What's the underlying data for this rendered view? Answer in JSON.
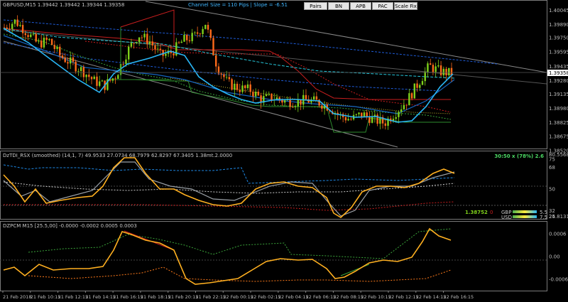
{
  "header": {
    "symbol": "GBPUSD,M15",
    "ohlc": "1.39442 1.39442 1.39344 1.39358",
    "channel": "Channel Size = 110 Pips  |  Slope = -6.51"
  },
  "toolbar": {
    "buttons": [
      "Pairs",
      "BN",
      "APB",
      "PAC",
      "Scale Fix"
    ]
  },
  "indicator1": {
    "label": "DzTDI_RSX (smoothed) (14,1, 7) 49.9533 27.0734 68.7979 62.8297 67.3405 1.38mt.2.0000",
    "info": "30:50 x (78%) 2.6",
    "value": "1.38752",
    "value2": "0",
    "gbp_label": "GBP",
    "usd_label": "USD",
    "gbp_value": "5.5",
    "usd_value": "7.5"
  },
  "indicator2": {
    "label": "DZPCM M15 [25.5,00] -0.0000 -0.0002 0.0005 0.0003"
  },
  "colors": {
    "background": "#000000",
    "bull": "#7fd11b",
    "bear": "#ff6a1a",
    "ma_fast": "#29b6f6",
    "ma_slow": "#1e88e5",
    "channel": "#9e9e9e",
    "resistance": "#cc2222",
    "support": "#2e8b2e"
  },
  "chart_data": [
    {
      "type": "candlestick",
      "symbol": "GBPUSD",
      "timeframe": "M15",
      "ylim": [
        1.3852,
        1.4005
      ],
      "yticks": [
        "1.40045",
        "1.39890",
        "1.39750",
        "1.39595",
        "1.39435",
        "1.39358",
        "1.39280",
        "1.39135",
        "1.38980",
        "1.38825",
        "1.38675",
        "1.38520"
      ],
      "current_price": "1.39358",
      "xticks": [
        "21 Feb 2018",
        "21 Feb 10:15",
        "21 Feb 12:15",
        "21 Feb 14:15",
        "21 Feb 16:15",
        "21 Feb 18:15",
        "21 Feb 20:15",
        "21 Feb 22:15",
        "22 Feb 00:15",
        "22 Feb 02:15",
        "22 Feb 04:15",
        "22 Feb 06:15",
        "22 Feb 08:15",
        "22 Feb 10:15",
        "22 Feb 12:15",
        "22 Feb 14:15",
        "22 Feb 16:15"
      ],
      "close_path": [
        1.3986,
        1.3993,
        1.3981,
        1.3968,
        1.3972,
        1.3955,
        1.3947,
        1.3939,
        1.3928,
        1.3923,
        1.3934,
        1.396,
        1.3978,
        1.3971,
        1.3955,
        1.3959,
        1.3972,
        1.3976,
        1.3991,
        1.3945,
        1.3925,
        1.392,
        1.3918,
        1.3908,
        1.391,
        1.3906,
        1.3905,
        1.3907,
        1.3905,
        1.39,
        1.389,
        1.3886,
        1.3892,
        1.3886,
        1.3882,
        1.3894,
        1.3906,
        1.3925,
        1.3944,
        1.3938,
        1.3936
      ]
    },
    {
      "type": "line",
      "title": "DzTDI_RSX",
      "ylim": [
        24.8131,
        80.5568
      ],
      "yticks": [
        "80.5568",
        "75",
        "68",
        "50",
        "32",
        "25",
        "24.8131"
      ],
      "series": [],
      "values": [
        60,
        36,
        42,
        31,
        37,
        60,
        74,
        79,
        48,
        48,
        54,
        38,
        34,
        34,
        59,
        61,
        58,
        45,
        26,
        39,
        43,
        54,
        58,
        66,
        72,
        65
      ]
    },
    {
      "type": "line",
      "title": "DZPCM M15",
      "ylim": [
        -0.0009,
        0.0009
      ],
      "yticks": [
        "0.0006",
        "0.00",
        "-0.0006"
      ],
      "values": [
        -0.0004,
        -0.0002,
        -0.0003,
        -0.0004,
        -0.0003,
        0.0002,
        0.0008,
        0.0006,
        0.0003,
        0.0004,
        -0.0007,
        -0.0007,
        -0.0002,
        -0.0001,
        0.0,
        0.0,
        -0.0003,
        -0.0001,
        0.0,
        0.0,
        0.0002,
        0.0008,
        0.0003
      ]
    }
  ]
}
